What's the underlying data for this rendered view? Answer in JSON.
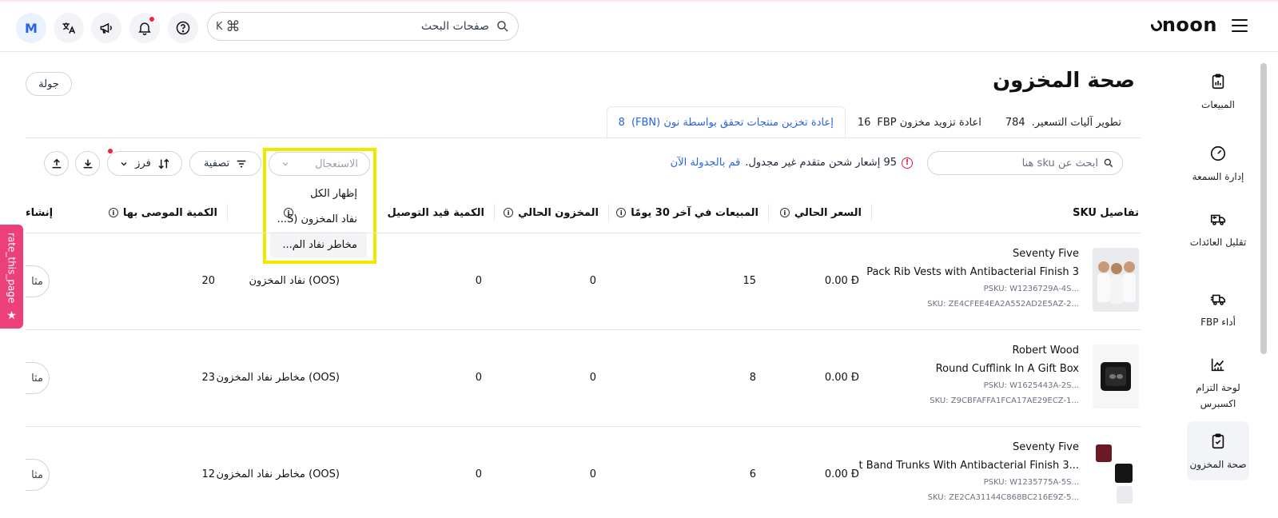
{
  "header": {
    "logo": "noon",
    "search_placeholder": "صفحات البحث",
    "search_shortcut": "K",
    "avatar_letter": "M"
  },
  "sidebar": {
    "items": [
      {
        "label": "المبيعات",
        "icon": "clipboard-chart-icon"
      },
      {
        "label": "إدارة السمعة",
        "icon": "gauge-icon"
      },
      {
        "label": "تقليل العائدات",
        "icon": "truck-return-icon"
      },
      {
        "label": "أداء FBP",
        "icon": "truck-fast-icon"
      },
      {
        "label": "لوحة التزام اكسبرس",
        "icon": "line-chart-icon"
      },
      {
        "label": "صحة المخزون",
        "icon": "clipboard-check-icon",
        "active": true
      }
    ]
  },
  "page": {
    "title": "صحة المخزون",
    "tour_label": "جولة"
  },
  "tabs": [
    {
      "label": "تطوير آليات التسعير.",
      "count": "784"
    },
    {
      "label": "اعادة تزويد مخزون FBP",
      "count": "16"
    },
    {
      "label": "إعادة تخزين منتجات تحقق بواسطة نون (FBN)",
      "count": "8",
      "active": true
    }
  ],
  "toolbar": {
    "search_placeholder": "ابحث عن sku هنا",
    "notice_text": "95 إشعار شحن متقدم غير مجدول.",
    "notice_link": "قم بالجدولة الآن",
    "urgency_placeholder": "الاستعجال",
    "urgency_options": [
      "إظهار الكل",
      "نفاد المخزون (S...",
      "مخاطر نفاد الم..."
    ],
    "filter_label": "تصفية",
    "sort_label": "فرز"
  },
  "table": {
    "headers": {
      "sku": "تفاصيل SKU",
      "price": "السعر الحالي",
      "sales30": "المبيعات في آخر 30 يومًا",
      "stock": "المخزون الحالي",
      "intransit": "الكمية قيد التوصيل",
      "status": "",
      "recommended": "الكمية الموصى بها",
      "create": "إنشاء"
    },
    "rows": [
      {
        "brand": "Seventy Five",
        "name": "Pack Rib Vests with Antibacterial Finish 3",
        "psku": "PSKU: W1236729A-4S...",
        "sku": "SKU: ZE4CFEE4EA2A552AD2E5AZ-2...",
        "price": "0.00",
        "currency": "Ð",
        "sales30": "15",
        "stock": "0",
        "intransit": "0",
        "status": "نفاد المخزون (OOS)",
        "recommended": "20",
        "action": "مثا"
      },
      {
        "brand": "Robert Wood",
        "name": "Round Cufflink In A Gift Box",
        "psku": "PSKU: W1625443A-2S...",
        "sku": "SKU: Z9CBFAFFA1FCA17AE29ECZ-1...",
        "price": "0.00",
        "currency": "Ð",
        "sales30": "8",
        "stock": "0",
        "intransit": "0",
        "status": "مخاطر نفاد المخزون (OOS)",
        "recommended": "23",
        "action": "مثا"
      },
      {
        "brand": "Seventy Five",
        "name": "t Band Trunks With Antibacterial Finish 3...",
        "psku": "PSKU: W1235775A-5S...",
        "sku": "SKU: ZE2CA31144C868BC216E9Z-5...",
        "price": "0.00",
        "currency": "Ð",
        "sales30": "6",
        "stock": "0",
        "intransit": "0",
        "status": "مخاطر نفاد المخزون (OOS)",
        "recommended": "12",
        "action": "مثا"
      }
    ]
  },
  "rate_tab": "rate_this_page"
}
